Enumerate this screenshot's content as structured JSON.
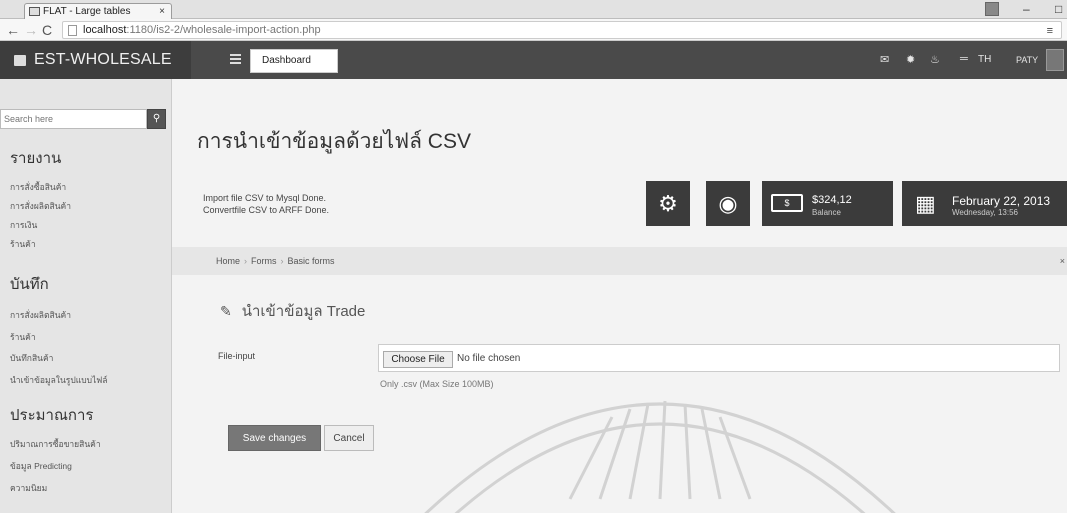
{
  "browser": {
    "tab_title": "FLAT - Large tables",
    "tab_close": "×",
    "url_host": "localhost",
    "url_path": ":1180/is2-2/wholesale-import-action.php",
    "min": "–",
    "max": "□",
    "menu": "≡"
  },
  "header": {
    "brand": "EST-WHOLESALE",
    "dashboard": "Dashboard",
    "lang": "TH",
    "user": "PATY"
  },
  "sidebar": {
    "search_placeholder": "Search here",
    "sections": [
      {
        "title": "รายงาน",
        "items": [
          "การสั่งซื้อสินค้า",
          "การสั่งผลิตสินค้า",
          "การเงิน",
          "ร้านค้า"
        ]
      },
      {
        "title": "บันทึก",
        "items": [
          "การสั่งผลิตสินค้า",
          "ร้านค้า",
          "บันทึกสินค้า",
          "นำเข้าข้อมูลในรูปแบบไฟล์"
        ]
      },
      {
        "title": "ประมาณการ",
        "items": [
          "ปริมาณการซื้อขายสินค้า",
          "ข้อมูล Predicting",
          "ความนิยม"
        ]
      }
    ]
  },
  "main": {
    "title": "การนำเข้าข้อมูลด้วยไฟล์ CSV",
    "messages": [
      "Import file CSV to Mysql Done.",
      "Convertfile CSV to ARFF Done."
    ],
    "balance_value": "$324,12",
    "balance_label": "Balance",
    "date_value": "February 22, 2013",
    "date_sub": "Wednesday, 13:56",
    "breadcrumb": [
      "Home",
      "Forms",
      "Basic forms"
    ],
    "breadcrumb_close": "×",
    "form_title": "นำเข้าข้อมูล Trade",
    "file_label": "File-input",
    "choose_file": "Choose File",
    "no_file": "No file chosen",
    "help": "Only .csv (Max Size 100MB)",
    "save": "Save changes",
    "cancel": "Cancel"
  },
  "colors": {
    "header": "#4a4a4a",
    "sidebar": "#e5e5e5",
    "stat_box": "#3b3b3b"
  },
  "icons": [
    "page-icon",
    "menu-icon",
    "mail-icon",
    "gear-icon",
    "fire-icon",
    "globe-icon",
    "money-icon",
    "calendar-icon",
    "edit-icon",
    "search-icon"
  ]
}
